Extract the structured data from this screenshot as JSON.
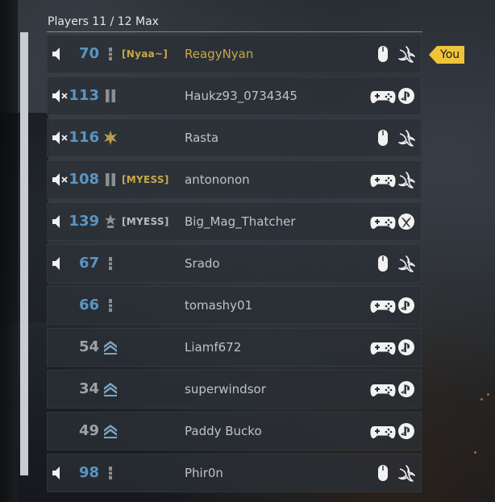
{
  "header": {
    "title": "Players 11 / 12 Max"
  },
  "colors": {
    "level_blue": "#5a95c4",
    "level_gray": "#9ea3a8",
    "name_gold": "#c7a84a",
    "name_gray": "#bfc3c7",
    "clan_gold": "#c7a84a",
    "clan_gray": "#b8bcc0",
    "you_badge": "#f0c43a"
  },
  "players": [
    {
      "voice": "on",
      "level": "70",
      "level_style": "blue",
      "rank_icon": "bar-rank-icon",
      "clan": "[Nyaa~]",
      "clan_style": "gold",
      "name": "ReagyNyan",
      "name_style": "gold",
      "input": "mouse-icon",
      "platform": "battlenet-icon",
      "you": "You"
    },
    {
      "voice": "muted",
      "level": "113",
      "level_style": "blue",
      "rank_icon": "double-bar-rank-icon",
      "clan": "",
      "clan_style": "gray",
      "name": "Haukz93_0734345",
      "name_style": "gray",
      "input": "controller-icon",
      "platform": "playstation-icon",
      "you": ""
    },
    {
      "voice": "muted",
      "level": "116",
      "level_style": "blue",
      "rank_icon": "star-burst-rank-icon",
      "clan": "",
      "clan_style": "gray",
      "name": "Rasta",
      "name_style": "gray",
      "input": "mouse-icon",
      "platform": "battlenet-icon",
      "you": ""
    },
    {
      "voice": "muted",
      "level": "108",
      "level_style": "blue",
      "rank_icon": "double-bar-rank-icon",
      "clan": "[MYESS]",
      "clan_style": "gold",
      "name": "antononon",
      "name_style": "gray",
      "input": "controller-icon",
      "platform": "battlenet-icon",
      "you": ""
    },
    {
      "voice": "on",
      "level": "139",
      "level_style": "blue",
      "rank_icon": "star-rank-icon",
      "clan": "[MYESS]",
      "clan_style": "gray",
      "name": "Big_Mag_Thatcher",
      "name_style": "gray",
      "input": "controller-icon",
      "platform": "xbox-icon",
      "you": ""
    },
    {
      "voice": "on",
      "level": "67",
      "level_style": "blue",
      "rank_icon": "bar-rank-icon",
      "clan": "",
      "clan_style": "gray",
      "name": "Srado",
      "name_style": "gray",
      "input": "mouse-icon",
      "platform": "battlenet-icon",
      "you": ""
    },
    {
      "voice": "none",
      "level": "66",
      "level_style": "blue",
      "rank_icon": "bar-rank-icon",
      "clan": "",
      "clan_style": "gray",
      "name": "tomashy01",
      "name_style": "gray",
      "input": "controller-icon",
      "platform": "playstation-icon",
      "you": ""
    },
    {
      "voice": "none",
      "level": "54",
      "level_style": "gray",
      "rank_icon": "chevron-rank-icon",
      "clan": "",
      "clan_style": "gray",
      "name": "Liamf672",
      "name_style": "gray",
      "input": "controller-icon",
      "platform": "playstation-icon",
      "you": ""
    },
    {
      "voice": "none",
      "level": "34",
      "level_style": "gray",
      "rank_icon": "chevron-rank-icon",
      "clan": "",
      "clan_style": "gray",
      "name": "superwindsor",
      "name_style": "gray",
      "input": "controller-icon",
      "platform": "playstation-icon",
      "you": ""
    },
    {
      "voice": "none",
      "level": "49",
      "level_style": "gray",
      "rank_icon": "chevron-rank-icon",
      "clan": "",
      "clan_style": "gray",
      "name": "Paddy Bucko",
      "name_style": "gray",
      "input": "controller-icon",
      "platform": "playstation-icon",
      "you": ""
    },
    {
      "voice": "on",
      "level": "98",
      "level_style": "blue",
      "rank_icon": "bar-rank-icon",
      "clan": "",
      "clan_style": "gray",
      "name": "Phir0n",
      "name_style": "gray",
      "input": "mouse-icon",
      "platform": "battlenet-icon",
      "you": ""
    }
  ]
}
